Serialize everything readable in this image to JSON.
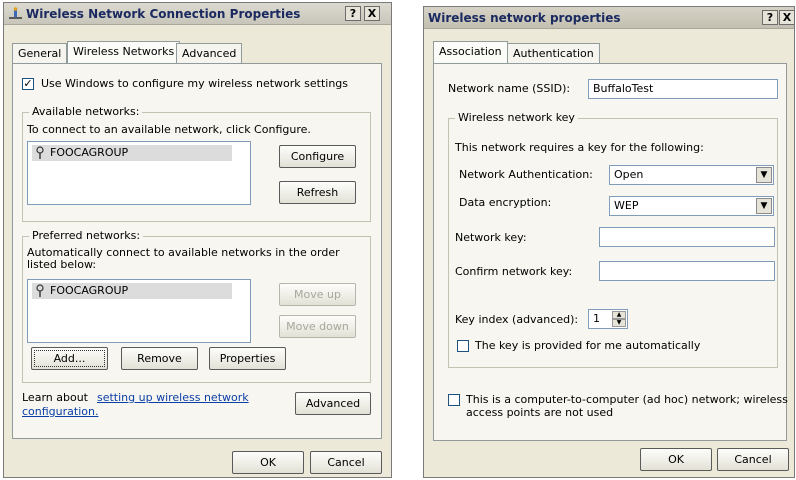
{
  "left": {
    "title": "Wireless Network Connection Properties",
    "help_btn": "?",
    "close_btn": "X",
    "tabs": [
      "General",
      "Wireless Networks",
      "Advanced"
    ],
    "use_windows_label": "Use Windows to configure my wireless network settings",
    "use_windows_checked": true,
    "available": {
      "legend": "Available networks:",
      "desc": "To connect to an available network, click Configure.",
      "items": [
        "FOOCAGROUP"
      ],
      "configure": "Configure",
      "refresh": "Refresh"
    },
    "preferred": {
      "legend": "Preferred networks:",
      "desc": "Automatically connect to available networks in the order listed below:",
      "items": [
        "FOOCAGROUP"
      ],
      "move_up": "Move up",
      "move_down": "Move down",
      "add": "Add...",
      "remove": "Remove",
      "properties": "Properties"
    },
    "learn_text": "Learn about ",
    "learn_link1": "setting up wireless network",
    "learn_link2": "configuration.",
    "advanced_btn": "Advanced",
    "ok": "OK",
    "cancel": "Cancel"
  },
  "right": {
    "title": "Wireless network properties",
    "help_btn": "?",
    "close_btn": "X",
    "tabs": [
      "Association",
      "Authentication"
    ],
    "ssid_label": "Network name (SSID):",
    "ssid_value": "BuffaloTest",
    "key_group": {
      "legend": "Wireless network key",
      "desc": "This network requires a key for the following:",
      "auth_label": "Network Authentication:",
      "auth_value": "Open",
      "enc_label": "Data encryption:",
      "enc_value": "WEP",
      "netkey_label": "Network key:",
      "netkey_value": "",
      "confirm_label": "Confirm network key:",
      "confirm_value": "",
      "index_label": "Key index (advanced):",
      "index_value": "1",
      "auto_label": "The key is provided for me automatically",
      "auto_checked": false
    },
    "adhoc_label_1": "This is a computer-to-computer (ad hoc) network; wireless",
    "adhoc_label_2": "access points are not used",
    "adhoc_checked": false,
    "ok": "OK",
    "cancel": "Cancel"
  }
}
